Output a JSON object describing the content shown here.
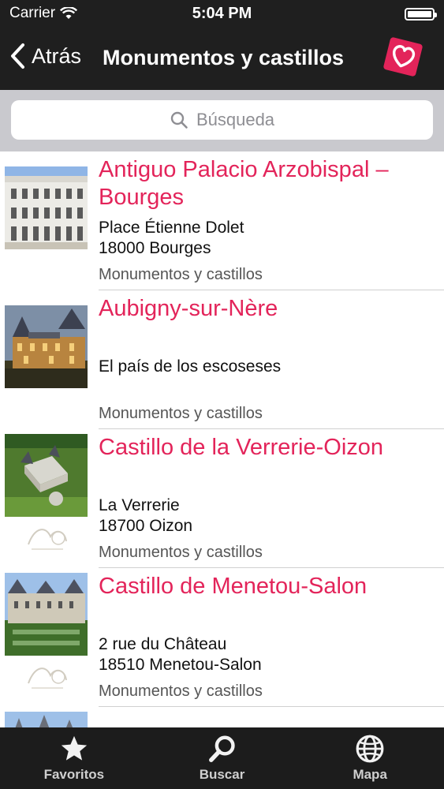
{
  "status_bar": {
    "carrier": "Carrier",
    "time": "5:04 PM"
  },
  "nav": {
    "back_label": "Atrás",
    "title": "Monumentos y castillos"
  },
  "search": {
    "placeholder": "Búsqueda"
  },
  "items": [
    {
      "title": "Antiguo Palacio Arzobispal – Bourges",
      "address_line1": "Place Étienne Dolet",
      "address_line2": "18000 Bourges",
      "category": "Monumentos y castillos"
    },
    {
      "title": "Aubigny-sur-Nère",
      "address_line1": "El país de los escoseses",
      "address_line2": "",
      "category": "Monumentos y castillos"
    },
    {
      "title": "Castillo de la Verrerie-Oizon",
      "address_line1": "La Verrerie",
      "address_line2": "18700 Oizon",
      "category": "Monumentos y castillos"
    },
    {
      "title": "Castillo de Menetou-Salon",
      "address_line1": "2 rue du Château",
      "address_line2": "18510 Menetou-Salon",
      "category": "Monumentos y castillos"
    }
  ],
  "tabs": [
    {
      "label": "Favoritos",
      "icon": "star-icon"
    },
    {
      "label": "Buscar",
      "icon": "magnifier-icon"
    },
    {
      "label": "Mapa",
      "icon": "globe-icon"
    }
  ],
  "colors": {
    "accent": "#e3245a",
    "bar": "#1f1f1f",
    "search_bg": "#c9c9ce"
  }
}
